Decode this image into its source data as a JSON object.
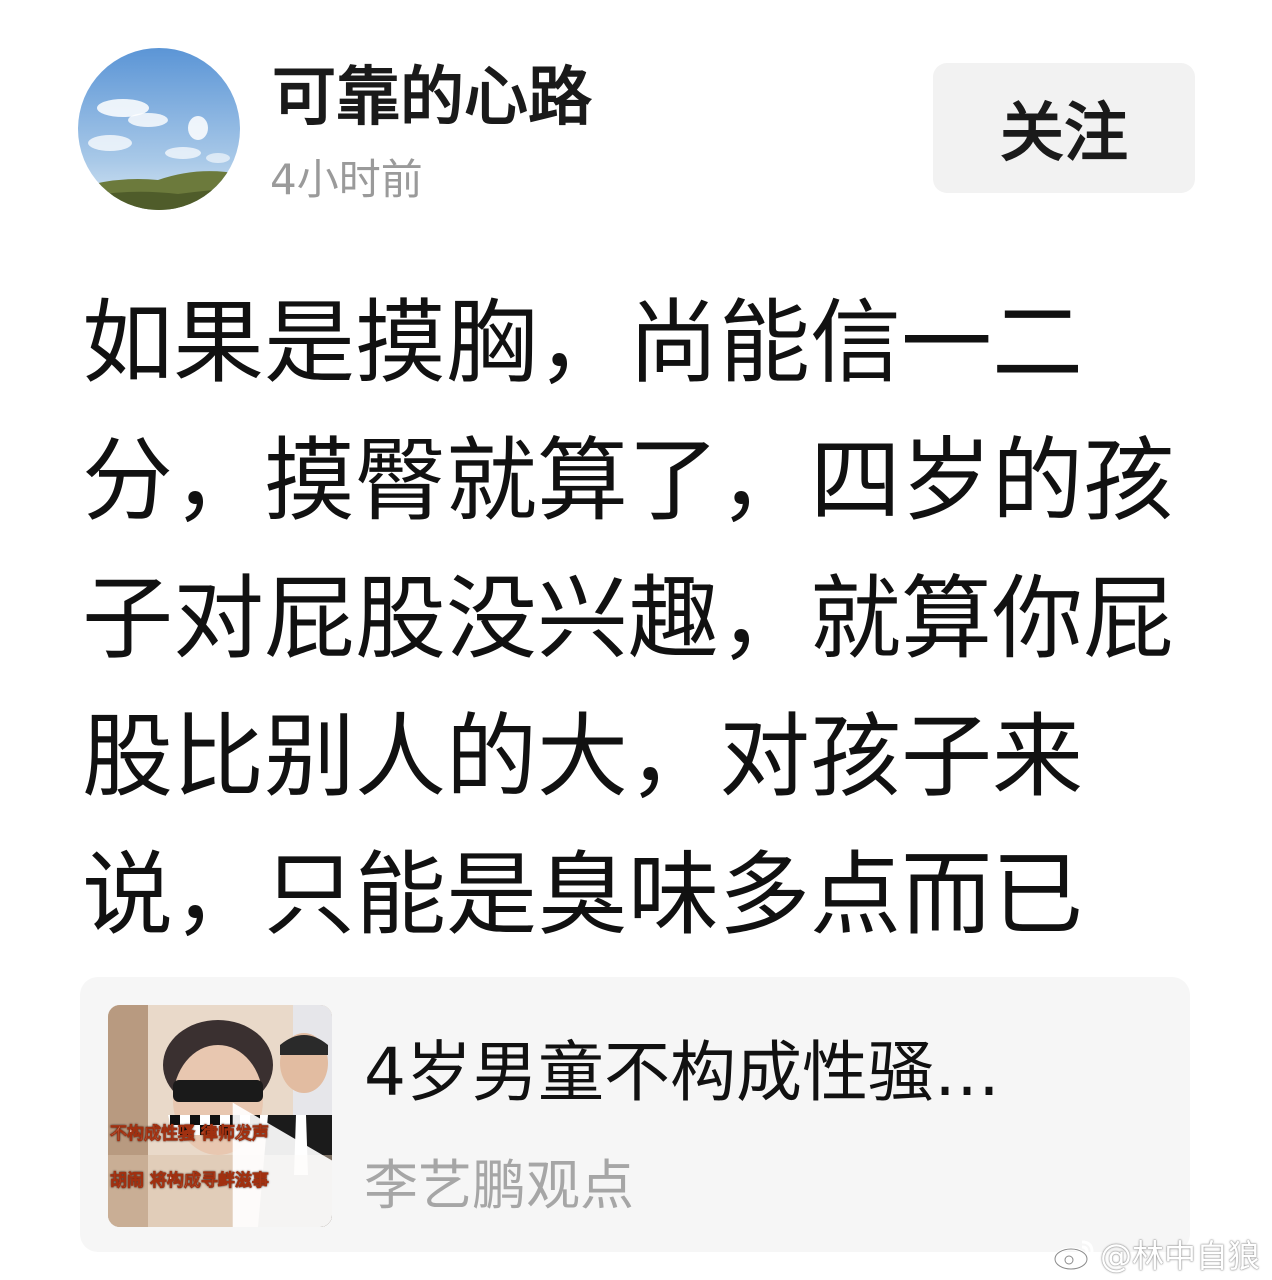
{
  "post": {
    "author": {
      "name": "可靠的心路",
      "avatar_icon": "sky-landscape-avatar"
    },
    "timestamp": "4小时前",
    "follow_label": "关注",
    "text_lines": [
      "如果是摸胸，尚能信一二",
      "分，摸臀就算了，四岁的孩",
      "子对屁股没兴趣，就算你屁",
      "股比别人的大，对孩子来",
      "说，只能是臭味多点而已"
    ]
  },
  "link_card": {
    "title": "4岁男童不构成性骚…",
    "source": "李艺鹏观点",
    "thumbnail": {
      "caption_line1": "不构成性骚 律师发声",
      "caption_line2": "胡闹 将构成寻衅滋事",
      "icon": "play-icon"
    }
  },
  "watermark": {
    "icon": "weibo-icon",
    "text": "@林中自狼"
  },
  "colors": {
    "text_primary": "#111111",
    "text_secondary": "#9a9a9a",
    "button_bg": "#f2f2f2",
    "card_bg": "#f6f6f6"
  }
}
